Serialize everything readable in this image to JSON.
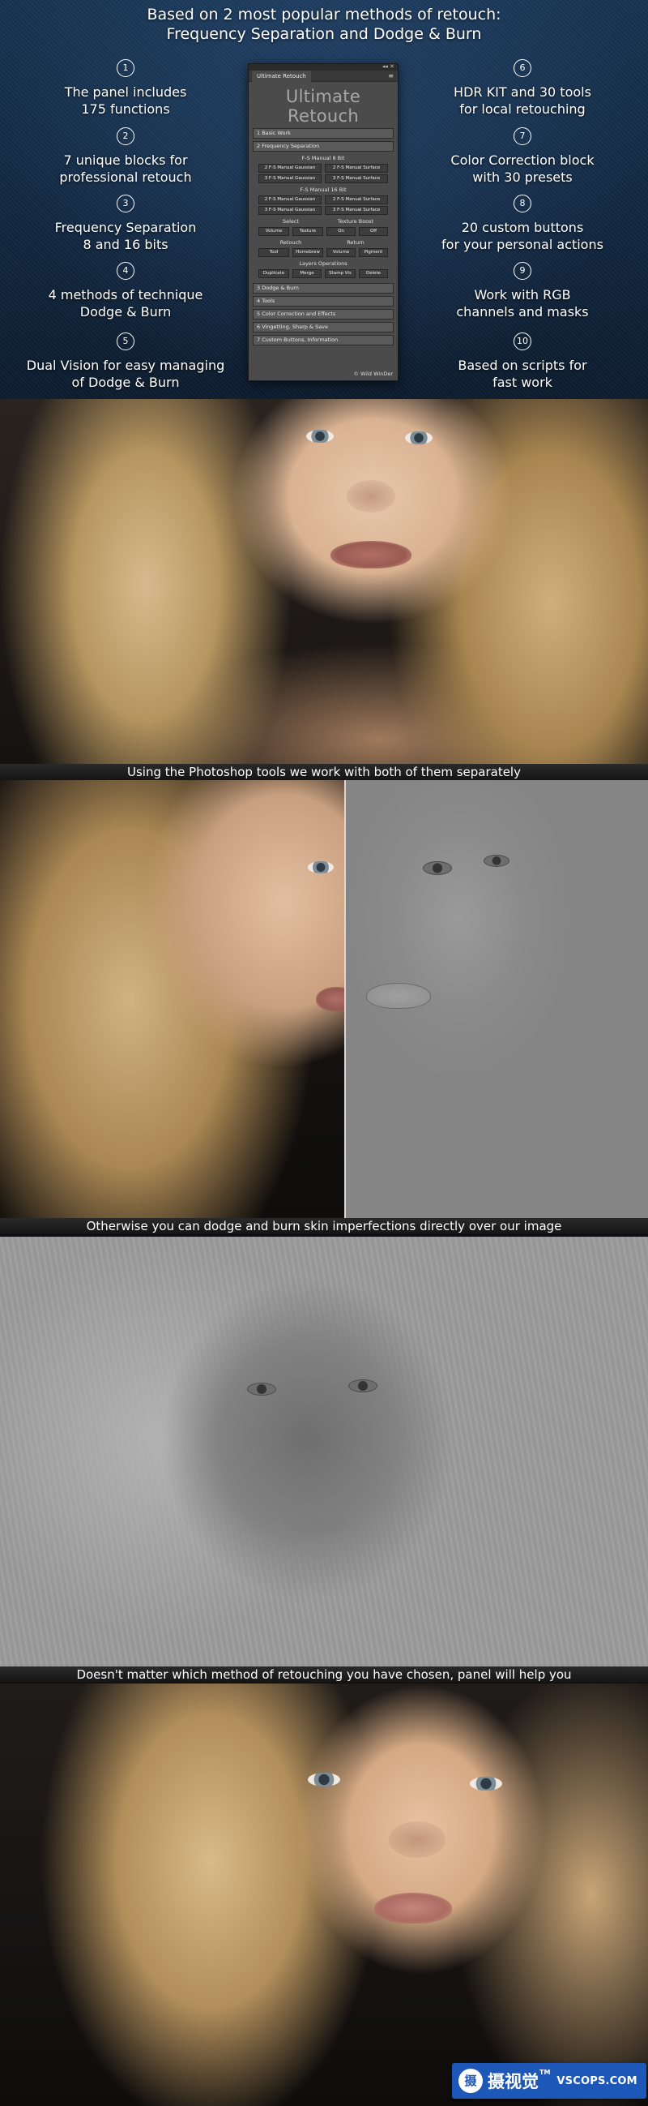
{
  "header": {
    "title_line1": "Based on 2 most popular methods of retouch:",
    "title_line2": "Frequency Separation and Dodge & Burn"
  },
  "features_left": [
    {
      "num": "1",
      "text": "The panel includes\n175 functions"
    },
    {
      "num": "2",
      "text": "7 unique blocks for\nprofessional retouch"
    },
    {
      "num": "3",
      "text": "Frequency Separation\n8 and 16 bits"
    },
    {
      "num": "4",
      "text": "4 methods of technique\nDodge & Burn"
    },
    {
      "num": "5",
      "text": "Dual Vision for easy managing\nof Dodge & Burn"
    }
  ],
  "features_right": [
    {
      "num": "6",
      "text": "HDR KIT and 30 tools\nfor local retouching"
    },
    {
      "num": "7",
      "text": "Color Correction block\nwith 30 presets"
    },
    {
      "num": "8",
      "text": "20 custom buttons\nfor your personal actions"
    },
    {
      "num": "9",
      "text": "Work with RGB\nchannels and masks"
    },
    {
      "num": "10",
      "text": "Based on scripts for\nfast work"
    }
  ],
  "panel": {
    "tab": "Ultimate Retouch",
    "menu": "≡",
    "controls": "◂◂ ✕",
    "logo": "Ultimate Retouch",
    "block1": "1 Basic Work",
    "block2": "2 Frequency Separation",
    "fs8_label": "F-S Manual 8 Bit",
    "fs8_buttons": [
      "2 F-S Manual Gaussian",
      "2 F-S Manual Surface",
      "3 F-S Manual Gaussian",
      "3 F-S Manual Surface"
    ],
    "fs16_label": "F-S Manual 16 Bit",
    "fs16_buttons": [
      "2 F-S Manual Gaussian",
      "2 F-S Manual Surface",
      "3 F-S Manual Gaussian",
      "3 F-S Manual Surface"
    ],
    "select_label": "Select",
    "texture_boost_label": "Texture Boost",
    "select_buttons": [
      "Volume",
      "Texture",
      "On",
      "Off"
    ],
    "retouch_label": "Retouch",
    "return_label": "Return",
    "retouch_buttons": [
      "Tool",
      "Homebrew",
      "Volume",
      "Pigment"
    ],
    "layers_label": "Layers Operations",
    "layers_buttons": [
      "Duplicate",
      "Merge",
      "Stamp Vis",
      "Delete"
    ],
    "blocks_rest": [
      "3 Dodge & Burn",
      "4 Tools",
      "5 Color Correction and Effects",
      "6 Vingetting, Sharp & Save",
      "7 Custom Buttons, Information"
    ],
    "footer": "© Wild WinDer"
  },
  "captions": {
    "c1": "Using the Photoshop tools we work with both of them separately",
    "c2": "Otherwise you can dodge and burn skin imperfections directly over our image",
    "c3": "Doesn't matter which method of retouching you have chosen, panel will help you"
  },
  "watermark": {
    "logo": "摄",
    "cn": "摄视觉",
    "sup": "TM",
    "en": "VSCOPS.COM",
    "color": "#1d58b8"
  }
}
